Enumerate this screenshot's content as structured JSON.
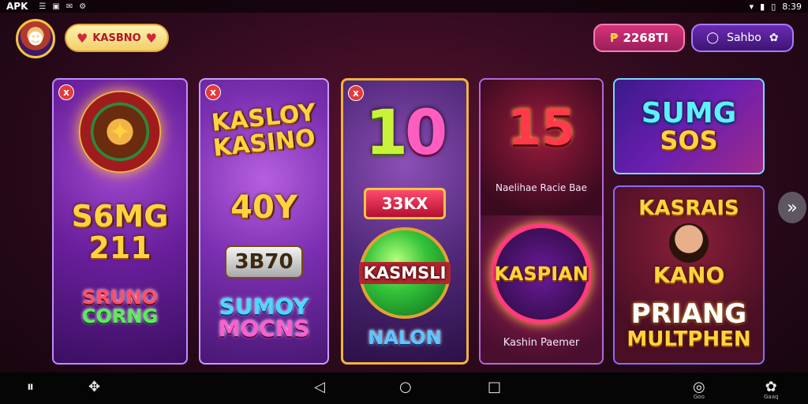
{
  "status_bar": {
    "app_label": "APK",
    "left_icons": [
      "☰",
      "▣",
      "✉",
      "⚙"
    ],
    "time": "8:39",
    "right_icons": [
      "wifi-icon",
      "signal-icon",
      "battery-icon"
    ]
  },
  "header": {
    "promo_text": "KASBNO",
    "coin_value": "2268TI",
    "user_label": "Sahbo"
  },
  "cards": {
    "card1": {
      "badge": "x",
      "title_line1": "S6MG",
      "title_line2": "211",
      "footer_line1": "SRUNO",
      "footer_line2": "CORNG"
    },
    "card2": {
      "title_line1": "KASLOY",
      "title_line2": "KASINO",
      "number": "40Y",
      "box_label": "3B70",
      "footer_line1": "SUMOY",
      "footer_line2": "MOCNS"
    },
    "card3": {
      "badge": "x",
      "big_left": "1",
      "big_right": "0",
      "bar_label": "33KX",
      "orb_label": "KASMSLI",
      "footer": "NALON"
    },
    "card4": {
      "big": "15",
      "caption_top": "Naelihae Racie Bae",
      "ring_label": "KASPIAN",
      "caption_bottom": "Kashin Paemer"
    },
    "card5": {
      "title_line1": "SUMG",
      "title_line2": "SOS"
    },
    "card6": {
      "title_line1": "KASRAIS",
      "title_line2": "KANO",
      "footer_line1": "PRIANG",
      "footer_line2": "MULTPHEN"
    }
  },
  "nav": {
    "right_label_1": "Goo",
    "right_label_2": "Gaaq"
  },
  "colors": {
    "gold": "#ffd33d",
    "coin_pill": "#d8327a",
    "user_pill": "#6b2ab4"
  }
}
